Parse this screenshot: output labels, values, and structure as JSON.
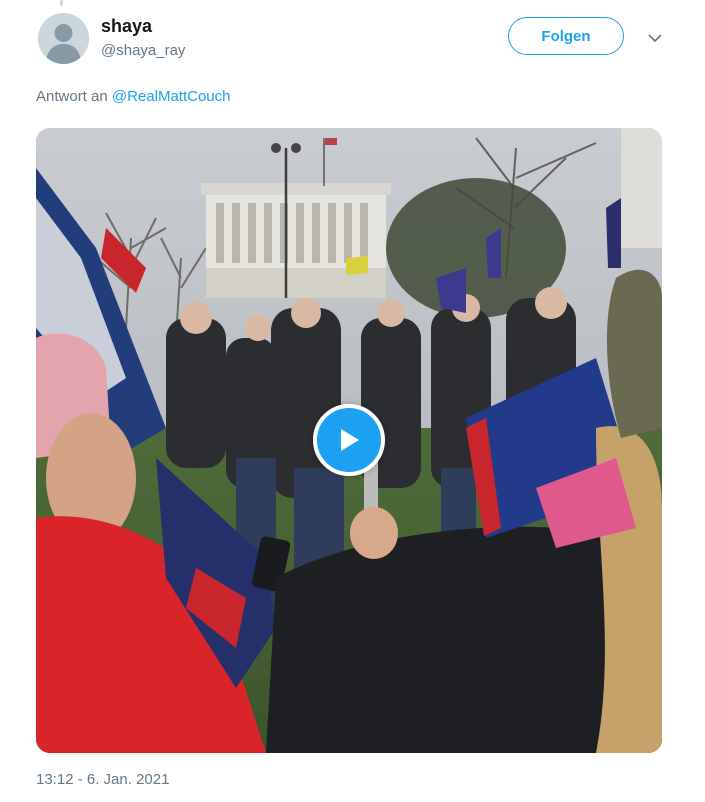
{
  "author": {
    "display_name": "shaya",
    "handle": "@shaya_ray",
    "avatar_icon": "default-avatar-icon"
  },
  "actions": {
    "follow_label": "Folgen",
    "more_icon": "chevron-down-icon"
  },
  "reply": {
    "prefix": "Antwort an ",
    "mention": "@RealMattCouch"
  },
  "media": {
    "type": "video",
    "play_icon": "play-icon"
  },
  "timestamp": "13:12 - 6. Jan. 2021",
  "colors": {
    "accent": "#1da1f2",
    "secondary_text": "#657786",
    "primary_text": "#14171a"
  }
}
